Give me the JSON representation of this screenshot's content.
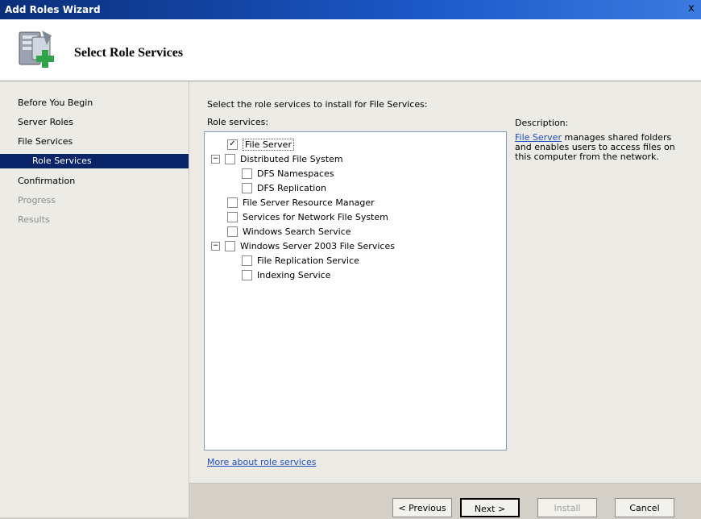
{
  "window": {
    "title": "Add Roles Wizard",
    "close_glyph": "x"
  },
  "header": {
    "title": "Select Role Services",
    "icon": "server-add-icon"
  },
  "nav": {
    "items": [
      {
        "label": "Before You Begin",
        "state": "normal"
      },
      {
        "label": "Server Roles",
        "state": "normal"
      },
      {
        "label": "File Services",
        "state": "normal"
      },
      {
        "label": "Role Services",
        "state": "selected"
      },
      {
        "label": "Confirmation",
        "state": "normal"
      },
      {
        "label": "Progress",
        "state": "disabled"
      },
      {
        "label": "Results",
        "state": "disabled"
      }
    ]
  },
  "main": {
    "instruction": "Select the role services to install for File Services:",
    "role_services_label": "Role services:",
    "tree": [
      {
        "label": "File Server",
        "level": 0,
        "checked": true,
        "expander": ""
      },
      {
        "label": "Distributed File System",
        "level": 0,
        "checked": false,
        "expander": "−"
      },
      {
        "label": "DFS Namespaces",
        "level": 1,
        "checked": false,
        "expander": ""
      },
      {
        "label": "DFS Replication",
        "level": 1,
        "checked": false,
        "expander": ""
      },
      {
        "label": "File Server Resource Manager",
        "level": 0,
        "checked": false,
        "expander": ""
      },
      {
        "label": "Services for Network File System",
        "level": 0,
        "checked": false,
        "expander": ""
      },
      {
        "label": "Windows Search Service",
        "level": 0,
        "checked": false,
        "expander": ""
      },
      {
        "label": "Windows Server 2003 File Services",
        "level": 0,
        "checked": false,
        "expander": "−"
      },
      {
        "label": "File Replication Service",
        "level": 1,
        "checked": false,
        "expander": ""
      },
      {
        "label": "Indexing Service",
        "level": 1,
        "checked": false,
        "expander": ""
      }
    ],
    "more_link": "More about role services",
    "description": {
      "title": "Description:",
      "link": "File Server",
      "text": " manages shared folders and enables users to access files on this computer from the network."
    }
  },
  "buttons": {
    "previous": "< Previous",
    "next": "Next >",
    "install": "Install",
    "cancel": "Cancel"
  },
  "colors": {
    "nav_selected_bg": "#0a246a",
    "link": "#1f4dbb",
    "titlebar": "#0a2e7a"
  }
}
